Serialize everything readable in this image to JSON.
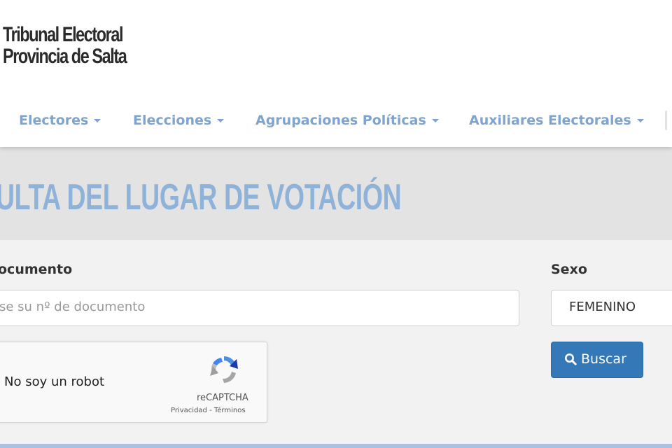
{
  "header": {
    "logo_line1": "Tribunal Electoral",
    "logo_line2": "Provincia de Salta"
  },
  "nav": {
    "items": [
      {
        "label": "Electores"
      },
      {
        "label": "Elecciones"
      },
      {
        "label": "Agrupaciones Políticas"
      },
      {
        "label": "Auxiliares Electorales"
      }
    ]
  },
  "page": {
    "title": "ULTA DEL LUGAR DE VOTACIÓN"
  },
  "form": {
    "documento_label": "ocumento",
    "documento_placeholder": "se su nº de documento",
    "sexo_label": "Sexo",
    "sexo_value": "FEMENINO",
    "buscar_label": "Buscar"
  },
  "captcha": {
    "label": "No soy un robot",
    "brand": "reCAPTCHA",
    "links": "Privacidad - Términos"
  },
  "colors": {
    "nav_text": "#7ea4cf",
    "title_text": "#8fb2d8",
    "button_bg": "#3478b8"
  }
}
